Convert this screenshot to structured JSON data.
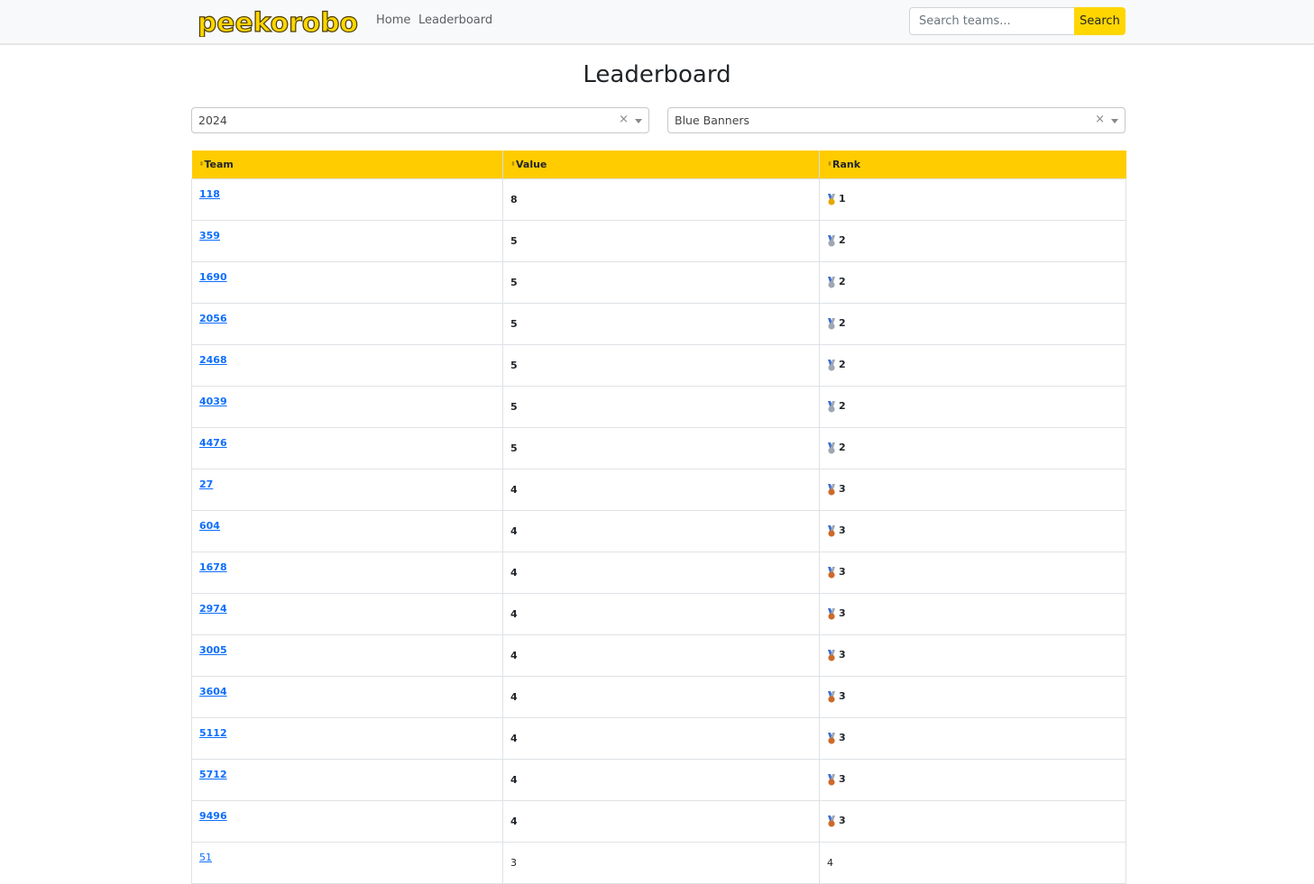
{
  "nav": {
    "logo_text": "peekorobo",
    "links": [
      {
        "label": "Home"
      },
      {
        "label": "Leaderboard"
      }
    ],
    "search": {
      "placeholder": "Search teams...",
      "button_label": "Search"
    }
  },
  "page_title": "Leaderboard",
  "filters": {
    "year": {
      "value": "2024",
      "clear": "×"
    },
    "stat": {
      "value": "Blue Banners",
      "clear": "×"
    }
  },
  "table": {
    "columns": [
      {
        "label": "Team"
      },
      {
        "label": "Value"
      },
      {
        "label": "Rank"
      }
    ],
    "rows": [
      {
        "team": "118",
        "value": "8",
        "rank": "1",
        "medal": "gold"
      },
      {
        "team": "359",
        "value": "5",
        "rank": "2",
        "medal": "silver"
      },
      {
        "team": "1690",
        "value": "5",
        "rank": "2",
        "medal": "silver"
      },
      {
        "team": "2056",
        "value": "5",
        "rank": "2",
        "medal": "silver"
      },
      {
        "team": "2468",
        "value": "5",
        "rank": "2",
        "medal": "silver"
      },
      {
        "team": "4039",
        "value": "5",
        "rank": "2",
        "medal": "silver"
      },
      {
        "team": "4476",
        "value": "5",
        "rank": "2",
        "medal": "silver"
      },
      {
        "team": "27",
        "value": "4",
        "rank": "3",
        "medal": "bronze"
      },
      {
        "team": "604",
        "value": "4",
        "rank": "3",
        "medal": "bronze"
      },
      {
        "team": "1678",
        "value": "4",
        "rank": "3",
        "medal": "bronze"
      },
      {
        "team": "2974",
        "value": "4",
        "rank": "3",
        "medal": "bronze"
      },
      {
        "team": "3005",
        "value": "4",
        "rank": "3",
        "medal": "bronze"
      },
      {
        "team": "3604",
        "value": "4",
        "rank": "3",
        "medal": "bronze"
      },
      {
        "team": "5112",
        "value": "4",
        "rank": "3",
        "medal": "bronze"
      },
      {
        "team": "5712",
        "value": "4",
        "rank": "3",
        "medal": "bronze"
      },
      {
        "team": "9496",
        "value": "4",
        "rank": "3",
        "medal": "bronze"
      },
      {
        "team": "51",
        "value": "3",
        "rank": "4",
        "medal": ""
      }
    ]
  },
  "colors": {
    "accent": "#ffd600",
    "header": "#ffcc00",
    "link": "#0d6efd",
    "medal_gold": "#e6a700",
    "medal_silver": "#9ea7b3",
    "medal_bronze": "#cd6a2a",
    "ribbon_blue": "#3b6fd6"
  }
}
